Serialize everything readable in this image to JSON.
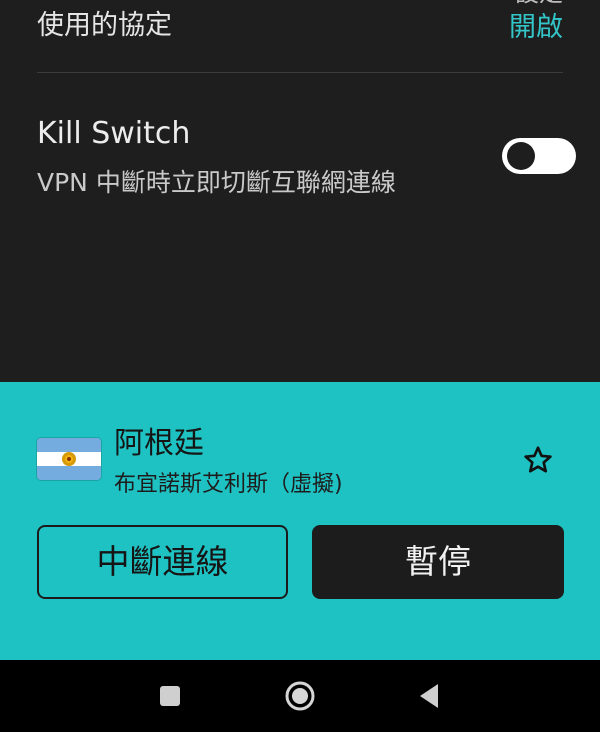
{
  "settings": {
    "cut_top_text": "設定",
    "protocol_label": "使用的協定",
    "protocol_value": "開啟",
    "kill_switch": {
      "title": "Kill Switch",
      "description": "VPN 中斷時立即切斷互聯網連線",
      "enabled": false
    }
  },
  "connection": {
    "country": "阿根廷",
    "city": "布宜諾斯艾利斯（虛擬)",
    "flag_icon": "argentina-flag-icon",
    "favorite_icon": "star-outline-icon",
    "disconnect_label": "中斷連線",
    "pause_label": "暫停"
  },
  "navbar": {
    "icons": [
      "square-recents-icon",
      "circle-home-icon",
      "triangle-back-icon"
    ]
  },
  "colors": {
    "accent": "#1fc2c2",
    "protocol_value": "#34c5c8",
    "background": "#1e1e1e"
  }
}
